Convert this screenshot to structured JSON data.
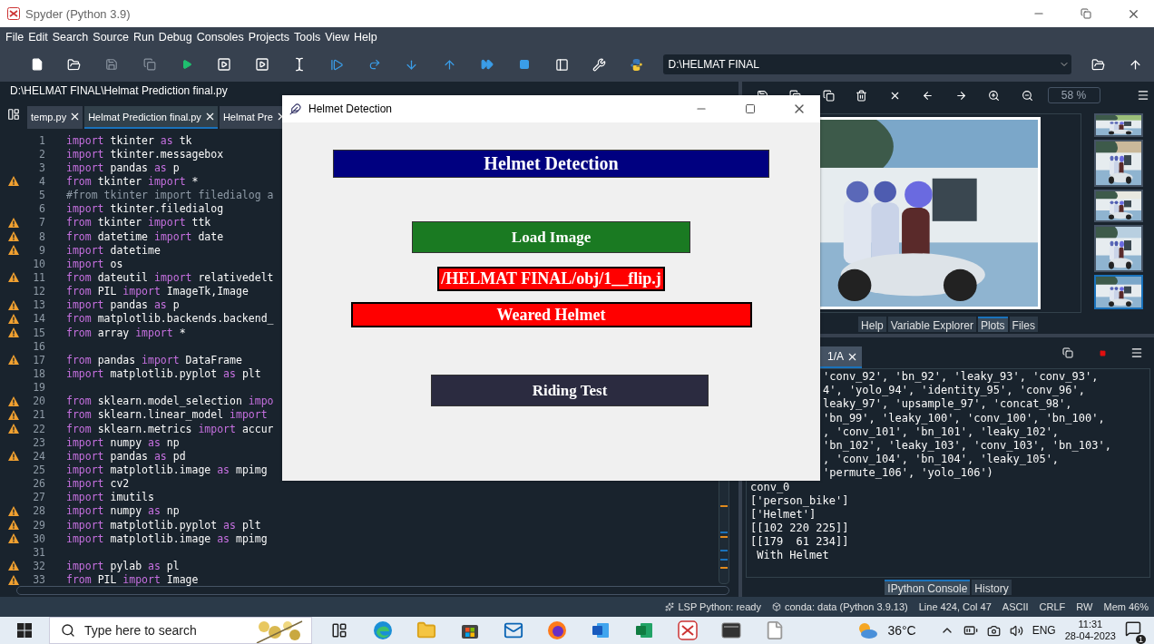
{
  "window": {
    "title": "Spyder (Python 3.9)"
  },
  "menu": [
    "File",
    "Edit",
    "Search",
    "Source",
    "Run",
    "Debug",
    "Consoles",
    "Projects",
    "Tools",
    "View",
    "Help"
  ],
  "toolbar": {
    "path": "D:\\HELMAT FINAL"
  },
  "editor": {
    "file_path": "D:\\HELMAT FINAL\\Helmat Prediction final.py",
    "tabs": [
      {
        "label": "temp.py",
        "selected": false
      },
      {
        "label": "Helmat Prediction final.py",
        "selected": true
      },
      {
        "label": "Helmat Pre",
        "selected": false
      }
    ],
    "lines": [
      {
        "number": "1",
        "warning": false,
        "tokens": [
          {
            "kind": "keyword",
            "text": "import"
          },
          {
            "kind": "name",
            "text": " tkinter "
          },
          {
            "kind": "keyword",
            "text": "as"
          },
          {
            "kind": "name",
            "text": " tk"
          }
        ]
      },
      {
        "number": "2",
        "warning": false,
        "tokens": [
          {
            "kind": "keyword",
            "text": "import"
          },
          {
            "kind": "name",
            "text": " tkinter.messagebox"
          }
        ]
      },
      {
        "number": "3",
        "warning": false,
        "tokens": [
          {
            "kind": "keyword",
            "text": "import"
          },
          {
            "kind": "name",
            "text": " pandas "
          },
          {
            "kind": "keyword",
            "text": "as"
          },
          {
            "kind": "name",
            "text": " p"
          }
        ]
      },
      {
        "number": "4",
        "warning": true,
        "tokens": [
          {
            "kind": "keyword",
            "text": "from"
          },
          {
            "kind": "name",
            "text": " tkinter "
          },
          {
            "kind": "keyword",
            "text": "import"
          },
          {
            "kind": "name",
            "text": " *"
          }
        ]
      },
      {
        "number": "5",
        "warning": false,
        "tokens": [
          {
            "kind": "comment",
            "text": "#from tkinter import filedialog a"
          }
        ]
      },
      {
        "number": "6",
        "warning": false,
        "tokens": [
          {
            "kind": "keyword",
            "text": "import"
          },
          {
            "kind": "name",
            "text": " tkinter.filedialog"
          }
        ]
      },
      {
        "number": "7",
        "warning": true,
        "tokens": [
          {
            "kind": "keyword",
            "text": "from"
          },
          {
            "kind": "name",
            "text": " tkinter "
          },
          {
            "kind": "keyword",
            "text": "import"
          },
          {
            "kind": "name",
            "text": " ttk"
          }
        ]
      },
      {
        "number": "8",
        "warning": true,
        "tokens": [
          {
            "kind": "keyword",
            "text": "from"
          },
          {
            "kind": "name",
            "text": " datetime "
          },
          {
            "kind": "keyword",
            "text": "import"
          },
          {
            "kind": "name",
            "text": " date"
          }
        ]
      },
      {
        "number": "9",
        "warning": true,
        "tokens": [
          {
            "kind": "keyword",
            "text": "import"
          },
          {
            "kind": "name",
            "text": " datetime"
          }
        ]
      },
      {
        "number": "10",
        "warning": false,
        "tokens": [
          {
            "kind": "keyword",
            "text": "import"
          },
          {
            "kind": "name",
            "text": " os"
          }
        ]
      },
      {
        "number": "11",
        "warning": true,
        "tokens": [
          {
            "kind": "keyword",
            "text": "from"
          },
          {
            "kind": "name",
            "text": " dateutil "
          },
          {
            "kind": "keyword",
            "text": "import"
          },
          {
            "kind": "name",
            "text": " relativedelt"
          }
        ]
      },
      {
        "number": "12",
        "warning": false,
        "tokens": [
          {
            "kind": "keyword",
            "text": "from"
          },
          {
            "kind": "name",
            "text": " PIL "
          },
          {
            "kind": "keyword",
            "text": "import"
          },
          {
            "kind": "name",
            "text": " ImageTk,Image"
          }
        ]
      },
      {
        "number": "13",
        "warning": true,
        "tokens": [
          {
            "kind": "keyword",
            "text": "import"
          },
          {
            "kind": "name",
            "text": " pandas "
          },
          {
            "kind": "keyword",
            "text": "as"
          },
          {
            "kind": "name",
            "text": " p"
          }
        ]
      },
      {
        "number": "14",
        "warning": true,
        "tokens": [
          {
            "kind": "keyword",
            "text": "from"
          },
          {
            "kind": "name",
            "text": " matplotlib.backends.backend_"
          }
        ]
      },
      {
        "number": "15",
        "warning": true,
        "tokens": [
          {
            "kind": "keyword",
            "text": "from"
          },
          {
            "kind": "name",
            "text": " array "
          },
          {
            "kind": "keyword",
            "text": "import"
          },
          {
            "kind": "name",
            "text": " *"
          }
        ]
      },
      {
        "number": "16",
        "warning": false
      },
      {
        "number": "17",
        "warning": true,
        "tokens": [
          {
            "kind": "keyword",
            "text": "from"
          },
          {
            "kind": "name",
            "text": " pandas "
          },
          {
            "kind": "keyword",
            "text": "import"
          },
          {
            "kind": "name",
            "text": " DataFrame"
          }
        ]
      },
      {
        "number": "18",
        "warning": false,
        "tokens": [
          {
            "kind": "keyword",
            "text": "import"
          },
          {
            "kind": "name",
            "text": " matplotlib.pyplot "
          },
          {
            "kind": "keyword",
            "text": "as"
          },
          {
            "kind": "name",
            "text": " plt"
          }
        ]
      },
      {
        "number": "19",
        "warning": false
      },
      {
        "number": "20",
        "warning": true,
        "tokens": [
          {
            "kind": "keyword",
            "text": "from"
          },
          {
            "kind": "name",
            "text": " sklearn.model_selection "
          },
          {
            "kind": "keyword",
            "text": "impo"
          }
        ]
      },
      {
        "number": "21",
        "warning": true,
        "tokens": [
          {
            "kind": "keyword",
            "text": "from"
          },
          {
            "kind": "name",
            "text": " sklearn.linear_model "
          },
          {
            "kind": "keyword",
            "text": "import"
          }
        ]
      },
      {
        "number": "22",
        "warning": true,
        "tokens": [
          {
            "kind": "keyword",
            "text": "from"
          },
          {
            "kind": "name",
            "text": " sklearn.metrics "
          },
          {
            "kind": "keyword",
            "text": "import"
          },
          {
            "kind": "name",
            "text": " accur"
          }
        ]
      },
      {
        "number": "23",
        "warning": false,
        "tokens": [
          {
            "kind": "keyword",
            "text": "import"
          },
          {
            "kind": "name",
            "text": " numpy "
          },
          {
            "kind": "keyword",
            "text": "as"
          },
          {
            "kind": "name",
            "text": " np"
          }
        ]
      },
      {
        "number": "24",
        "warning": true,
        "tokens": [
          {
            "kind": "keyword",
            "text": "import"
          },
          {
            "kind": "name",
            "text": " pandas "
          },
          {
            "kind": "keyword",
            "text": "as"
          },
          {
            "kind": "name",
            "text": " pd"
          }
        ]
      },
      {
        "number": "25",
        "warning": false,
        "tokens": [
          {
            "kind": "keyword",
            "text": "import"
          },
          {
            "kind": "name",
            "text": " matplotlib.image "
          },
          {
            "kind": "keyword",
            "text": "as"
          },
          {
            "kind": "name",
            "text": " mpimg"
          }
        ]
      },
      {
        "number": "26",
        "warning": false,
        "tokens": [
          {
            "kind": "keyword",
            "text": "import"
          },
          {
            "kind": "name",
            "text": " cv2"
          }
        ]
      },
      {
        "number": "27",
        "warning": false,
        "tokens": [
          {
            "kind": "keyword",
            "text": "import"
          },
          {
            "kind": "name",
            "text": " imutils"
          }
        ]
      },
      {
        "number": "28",
        "warning": true,
        "tokens": [
          {
            "kind": "keyword",
            "text": "import"
          },
          {
            "kind": "name",
            "text": " numpy "
          },
          {
            "kind": "keyword",
            "text": "as"
          },
          {
            "kind": "name",
            "text": " np"
          }
        ]
      },
      {
        "number": "29",
        "warning": true,
        "tokens": [
          {
            "kind": "keyword",
            "text": "import"
          },
          {
            "kind": "name",
            "text": " matplotlib.pyplot "
          },
          {
            "kind": "keyword",
            "text": "as"
          },
          {
            "kind": "name",
            "text": " plt"
          }
        ]
      },
      {
        "number": "30",
        "warning": true,
        "tokens": [
          {
            "kind": "keyword",
            "text": "import"
          },
          {
            "kind": "name",
            "text": " matplotlib.image "
          },
          {
            "kind": "keyword",
            "text": "as"
          },
          {
            "kind": "name",
            "text": " mpimg"
          }
        ]
      },
      {
        "number": "31",
        "warning": false
      },
      {
        "number": "32",
        "warning": true,
        "tokens": [
          {
            "kind": "keyword",
            "text": "import"
          },
          {
            "kind": "name",
            "text": " pylab "
          },
          {
            "kind": "keyword",
            "text": "as"
          },
          {
            "kind": "name",
            "text": " pl"
          }
        ]
      },
      {
        "number": "33",
        "warning": true,
        "tokens": [
          {
            "kind": "keyword",
            "text": "from"
          },
          {
            "kind": "name",
            "text": " PIL "
          },
          {
            "kind": "keyword",
            "text": "import"
          },
          {
            "kind": "name",
            "text": " Image"
          }
        ]
      }
    ]
  },
  "plots": {
    "zoom": "58 %",
    "thumbnails": [
      {
        "selected": false
      },
      {
        "selected": false
      },
      {
        "selected": false
      },
      {
        "selected": false
      },
      {
        "selected": true
      }
    ],
    "tabs": [
      {
        "label": "Help",
        "selected": false
      },
      {
        "label": "Variable Explorer",
        "selected": false
      },
      {
        "label": "Plots",
        "selected": true
      },
      {
        "label": "Files",
        "selected": false
      }
    ]
  },
  "console": {
    "tab": {
      "label": "1/A",
      "selected": true
    },
    "lines": [
      {
        "kind": "cut",
        "text": "'conv_92', 'bn_92', 'leaky_93', 'conv_93',"
      },
      {
        "kind": "cut",
        "text": "4', 'yolo_94', 'identity_95', 'conv_96',"
      },
      {
        "kind": "cut",
        "text": "leaky_97', 'upsample_97', 'concat_98',"
      },
      {
        "kind": "cut",
        "text": "'bn_99', 'leaky_100', 'conv_100', 'bn_100',"
      },
      {
        "kind": "cut",
        "text": ", 'conv_101', 'bn_101', 'leaky_102',"
      },
      {
        "kind": "cut",
        "text": "'bn_102', 'leaky_103', 'conv_103', 'bn_103',"
      },
      {
        "kind": "cut",
        "text": ", 'conv_104', 'bn_104', 'leaky_105',"
      },
      {
        "kind": "cut",
        "text": "'permute_106', 'yolo_106')"
      },
      {
        "kind": "full",
        "text": "conv_0"
      },
      {
        "kind": "full",
        "text": "['person_bike']"
      },
      {
        "kind": "full",
        "text": "['Helmet']"
      },
      {
        "kind": "full",
        "text": "[[102 220 225]]"
      },
      {
        "kind": "full",
        "text": "[[179  61 234]]"
      },
      {
        "kind": "full",
        "text": " With Helmet"
      }
    ],
    "tabs": [
      {
        "label": "IPython Console",
        "selected": true
      },
      {
        "label": "History",
        "selected": false
      }
    ]
  },
  "status_bar": [
    "LSP Python: ready",
    "conda: data (Python 3.9.13)",
    "Line 424, Col 47",
    "ASCII",
    "CRLF",
    "RW",
    "Mem 46%"
  ],
  "taskbar": {
    "search": {
      "placeholder": "Type here to search"
    },
    "weather": "36°C",
    "language": "ENG",
    "time": "11:31",
    "date": "28-04-2023",
    "notifications": "1"
  },
  "dialog": {
    "title": "Helmet Detection",
    "heading": "Helmet Detection",
    "load_button": "Load Image",
    "file_label": "/HELMAT FINAL/obj/1__flip.j",
    "result": "Weared Helmet",
    "riding_button": "Riding Test"
  }
}
